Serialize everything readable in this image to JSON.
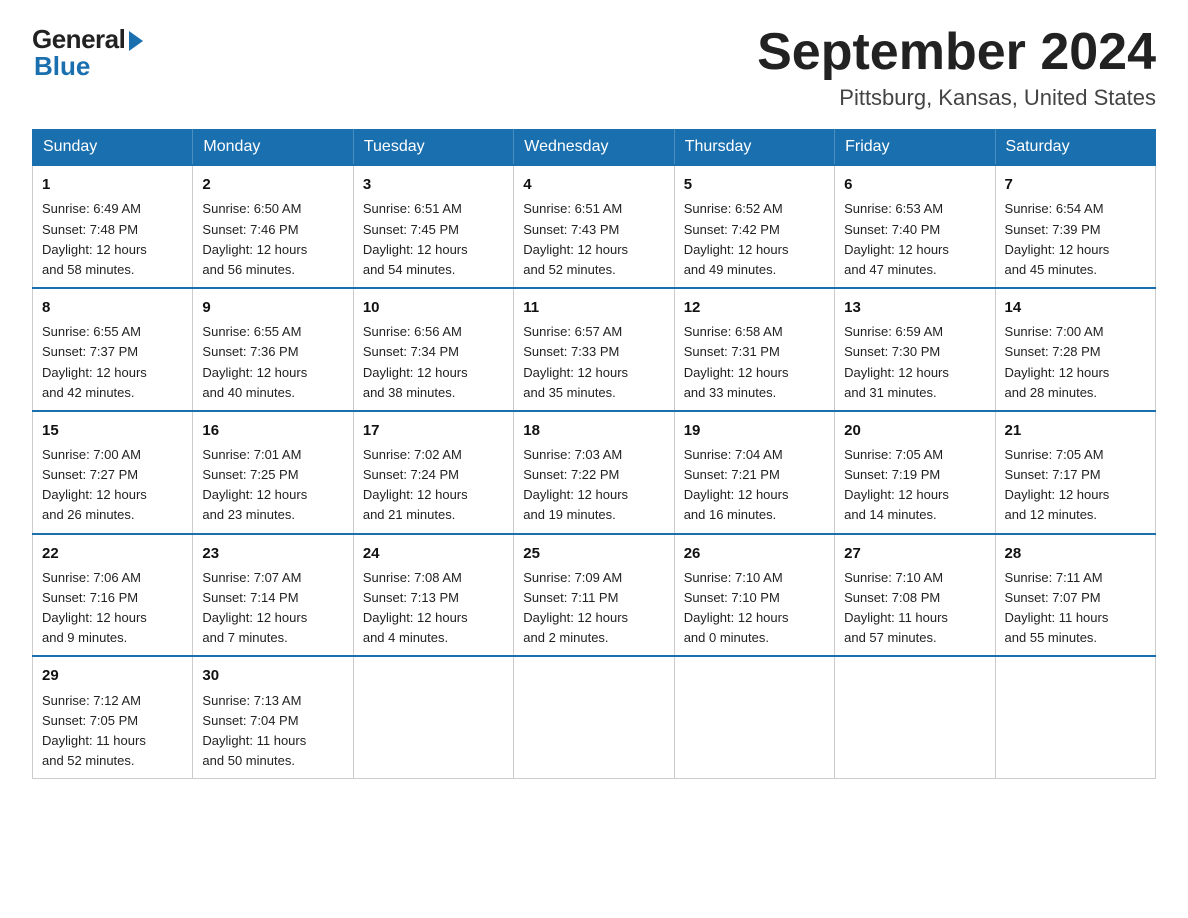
{
  "header": {
    "logo_general": "General",
    "logo_blue": "Blue",
    "month_year": "September 2024",
    "location": "Pittsburg, Kansas, United States"
  },
  "days_of_week": [
    "Sunday",
    "Monday",
    "Tuesday",
    "Wednesday",
    "Thursday",
    "Friday",
    "Saturday"
  ],
  "weeks": [
    [
      {
        "day": "1",
        "sunrise": "6:49 AM",
        "sunset": "7:48 PM",
        "daylight": "12 hours and 58 minutes."
      },
      {
        "day": "2",
        "sunrise": "6:50 AM",
        "sunset": "7:46 PM",
        "daylight": "12 hours and 56 minutes."
      },
      {
        "day": "3",
        "sunrise": "6:51 AM",
        "sunset": "7:45 PM",
        "daylight": "12 hours and 54 minutes."
      },
      {
        "day": "4",
        "sunrise": "6:51 AM",
        "sunset": "7:43 PM",
        "daylight": "12 hours and 52 minutes."
      },
      {
        "day": "5",
        "sunrise": "6:52 AM",
        "sunset": "7:42 PM",
        "daylight": "12 hours and 49 minutes."
      },
      {
        "day": "6",
        "sunrise": "6:53 AM",
        "sunset": "7:40 PM",
        "daylight": "12 hours and 47 minutes."
      },
      {
        "day": "7",
        "sunrise": "6:54 AM",
        "sunset": "7:39 PM",
        "daylight": "12 hours and 45 minutes."
      }
    ],
    [
      {
        "day": "8",
        "sunrise": "6:55 AM",
        "sunset": "7:37 PM",
        "daylight": "12 hours and 42 minutes."
      },
      {
        "day": "9",
        "sunrise": "6:55 AM",
        "sunset": "7:36 PM",
        "daylight": "12 hours and 40 minutes."
      },
      {
        "day": "10",
        "sunrise": "6:56 AM",
        "sunset": "7:34 PM",
        "daylight": "12 hours and 38 minutes."
      },
      {
        "day": "11",
        "sunrise": "6:57 AM",
        "sunset": "7:33 PM",
        "daylight": "12 hours and 35 minutes."
      },
      {
        "day": "12",
        "sunrise": "6:58 AM",
        "sunset": "7:31 PM",
        "daylight": "12 hours and 33 minutes."
      },
      {
        "day": "13",
        "sunrise": "6:59 AM",
        "sunset": "7:30 PM",
        "daylight": "12 hours and 31 minutes."
      },
      {
        "day": "14",
        "sunrise": "7:00 AM",
        "sunset": "7:28 PM",
        "daylight": "12 hours and 28 minutes."
      }
    ],
    [
      {
        "day": "15",
        "sunrise": "7:00 AM",
        "sunset": "7:27 PM",
        "daylight": "12 hours and 26 minutes."
      },
      {
        "day": "16",
        "sunrise": "7:01 AM",
        "sunset": "7:25 PM",
        "daylight": "12 hours and 23 minutes."
      },
      {
        "day": "17",
        "sunrise": "7:02 AM",
        "sunset": "7:24 PM",
        "daylight": "12 hours and 21 minutes."
      },
      {
        "day": "18",
        "sunrise": "7:03 AM",
        "sunset": "7:22 PM",
        "daylight": "12 hours and 19 minutes."
      },
      {
        "day": "19",
        "sunrise": "7:04 AM",
        "sunset": "7:21 PM",
        "daylight": "12 hours and 16 minutes."
      },
      {
        "day": "20",
        "sunrise": "7:05 AM",
        "sunset": "7:19 PM",
        "daylight": "12 hours and 14 minutes."
      },
      {
        "day": "21",
        "sunrise": "7:05 AM",
        "sunset": "7:17 PM",
        "daylight": "12 hours and 12 minutes."
      }
    ],
    [
      {
        "day": "22",
        "sunrise": "7:06 AM",
        "sunset": "7:16 PM",
        "daylight": "12 hours and 9 minutes."
      },
      {
        "day": "23",
        "sunrise": "7:07 AM",
        "sunset": "7:14 PM",
        "daylight": "12 hours and 7 minutes."
      },
      {
        "day": "24",
        "sunrise": "7:08 AM",
        "sunset": "7:13 PM",
        "daylight": "12 hours and 4 minutes."
      },
      {
        "day": "25",
        "sunrise": "7:09 AM",
        "sunset": "7:11 PM",
        "daylight": "12 hours and 2 minutes."
      },
      {
        "day": "26",
        "sunrise": "7:10 AM",
        "sunset": "7:10 PM",
        "daylight": "12 hours and 0 minutes."
      },
      {
        "day": "27",
        "sunrise": "7:10 AM",
        "sunset": "7:08 PM",
        "daylight": "11 hours and 57 minutes."
      },
      {
        "day": "28",
        "sunrise": "7:11 AM",
        "sunset": "7:07 PM",
        "daylight": "11 hours and 55 minutes."
      }
    ],
    [
      {
        "day": "29",
        "sunrise": "7:12 AM",
        "sunset": "7:05 PM",
        "daylight": "11 hours and 52 minutes."
      },
      {
        "day": "30",
        "sunrise": "7:13 AM",
        "sunset": "7:04 PM",
        "daylight": "11 hours and 50 minutes."
      },
      null,
      null,
      null,
      null,
      null
    ]
  ],
  "labels": {
    "sunrise": "Sunrise:",
    "sunset": "Sunset:",
    "daylight": "Daylight:"
  }
}
